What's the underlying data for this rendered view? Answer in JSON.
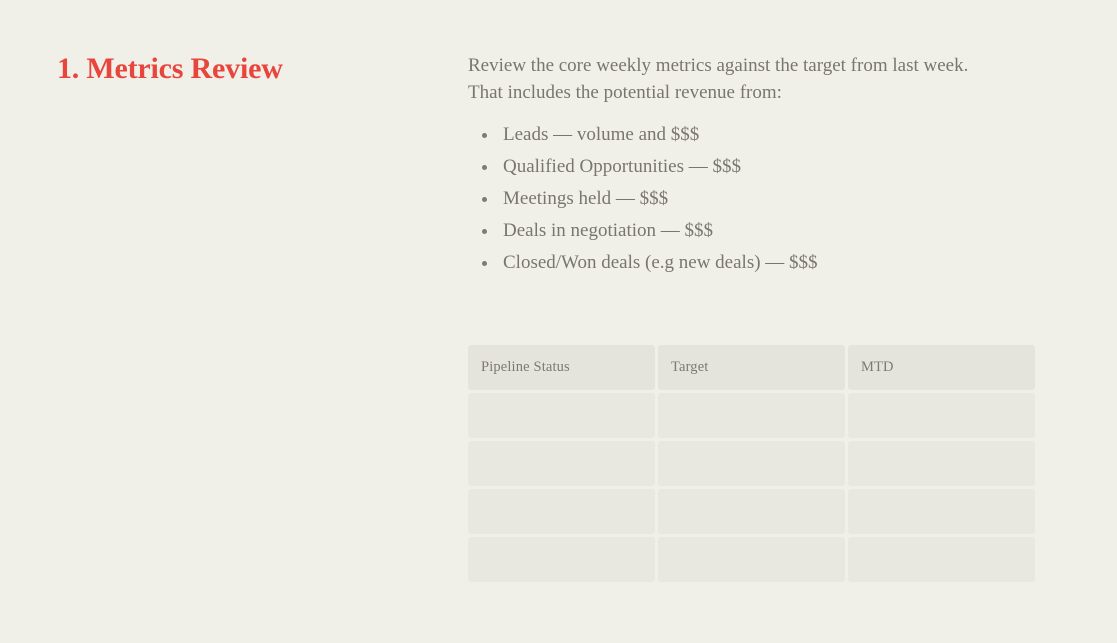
{
  "slide": {
    "background_color": "#f0f0e9",
    "accent_color": "#e8453c",
    "text_color": "#78766d"
  },
  "title": "1. Metrics Review",
  "intro": "Review the core weekly metrics against the target from last week. That includes the potential revenue from:",
  "bullets": [
    "Leads — volume and $$$",
    "Qualified Opportunities — $$$",
    "Meetings held — $$$",
    "Deals in negotiation — $$$",
    "Closed/Won deals (e.g new deals) — $$$"
  ],
  "table": {
    "headers": [
      "Pipeline Status",
      "Target",
      "MTD"
    ],
    "rows": [
      [
        "",
        "",
        ""
      ],
      [
        "",
        "",
        ""
      ],
      [
        "",
        "",
        ""
      ],
      [
        "",
        "",
        ""
      ]
    ]
  }
}
